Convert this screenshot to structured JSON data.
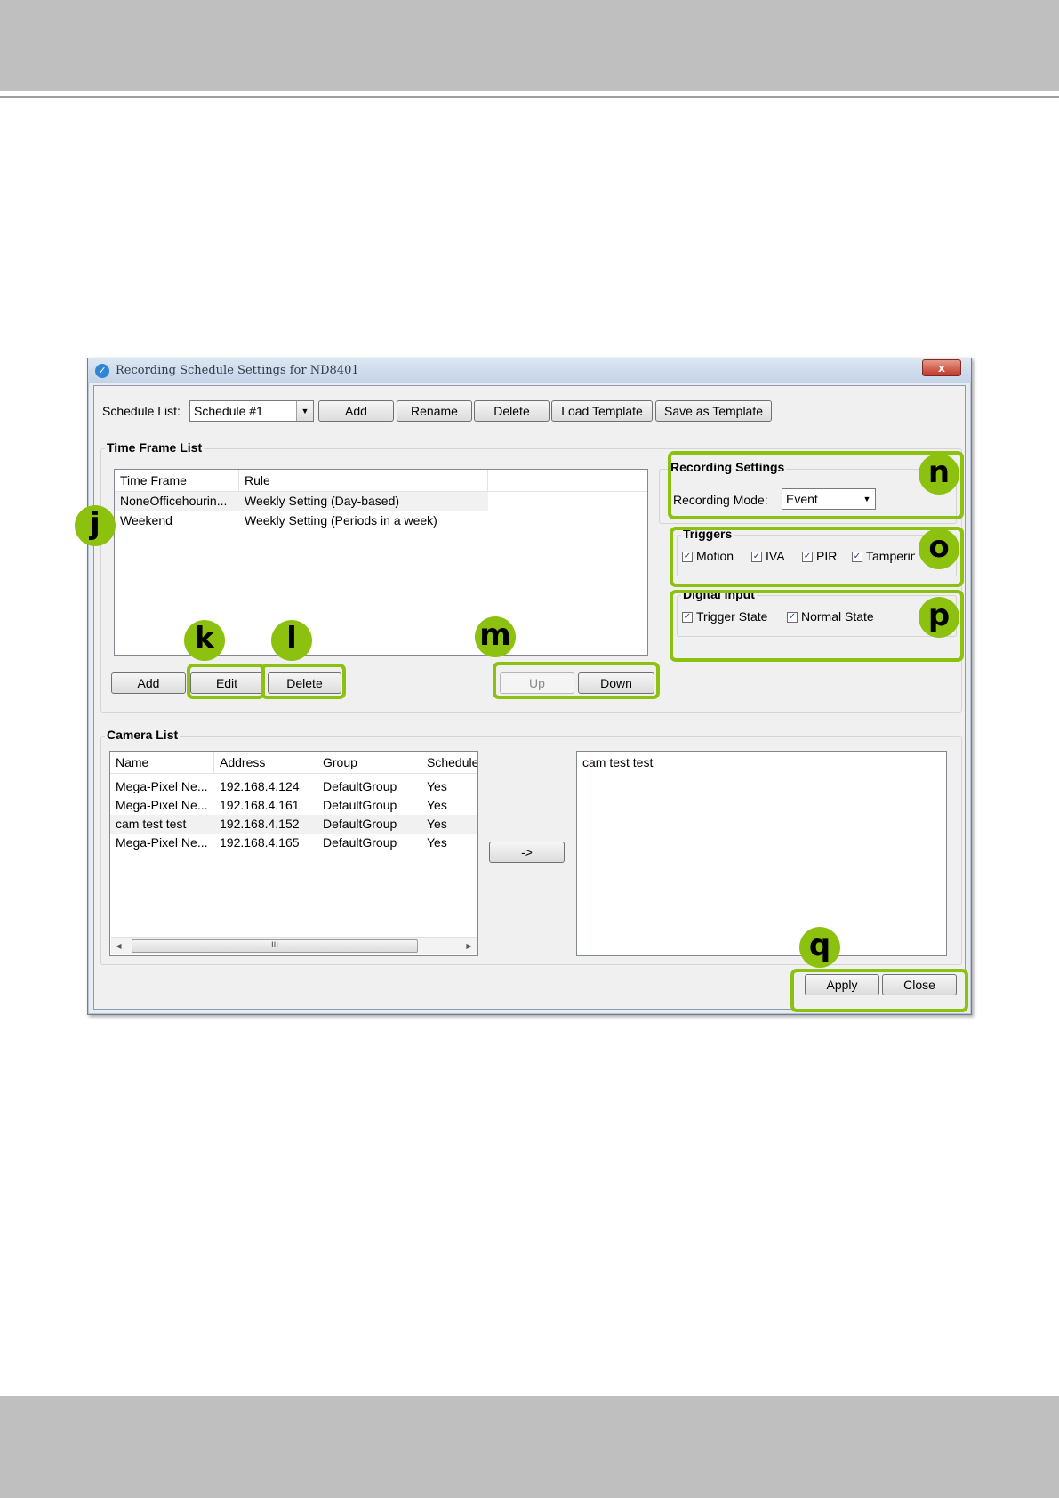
{
  "window": {
    "title": "Recording Schedule Settings for ND8401",
    "close_glyph": "x"
  },
  "schedule": {
    "label": "Schedule List:",
    "selected": "Schedule #1",
    "buttons": {
      "add": "Add",
      "rename": "Rename",
      "delete": "Delete",
      "load_template": "Load Template",
      "save_template": "Save as Template"
    }
  },
  "time_frame": {
    "title": "Time Frame List",
    "columns": [
      "Time Frame",
      "Rule"
    ],
    "rows": [
      {
        "time_frame": "NoneOfficehourin...",
        "rule": "Weekly Setting (Day-based)"
      },
      {
        "time_frame": "Weekend",
        "rule": "Weekly Setting (Periods in a week)"
      }
    ],
    "buttons": {
      "add": "Add",
      "edit": "Edit",
      "delete": "Delete",
      "up": "Up",
      "down": "Down"
    }
  },
  "recording_settings": {
    "title": "Recording Settings",
    "mode_label": "Recording Mode:",
    "mode_value": "Event"
  },
  "triggers": {
    "title": "Triggers",
    "items": [
      {
        "label": "Motion",
        "checked": true
      },
      {
        "label": "IVA",
        "checked": true
      },
      {
        "label": "PIR",
        "checked": true
      },
      {
        "label": "Tamperin",
        "checked": true
      }
    ]
  },
  "digital_input": {
    "title": "Digital Input",
    "items": [
      {
        "label": "Trigger State",
        "checked": true
      },
      {
        "label": "Normal State",
        "checked": true
      }
    ]
  },
  "camera_list": {
    "title": "Camera List",
    "columns": [
      "Name",
      "Address",
      "Group",
      "Schedule"
    ],
    "rows": [
      {
        "name": "Mega-Pixel Ne...",
        "address": "192.168.4.124",
        "group": "DefaultGroup",
        "schedule": "Yes"
      },
      {
        "name": "Mega-Pixel Ne...",
        "address": "192.168.4.161",
        "group": "DefaultGroup",
        "schedule": "Yes"
      },
      {
        "name": "cam test test",
        "address": "192.168.4.152",
        "group": "DefaultGroup",
        "schedule": "Yes"
      },
      {
        "name": "Mega-Pixel Ne...",
        "address": "192.168.4.165",
        "group": "DefaultGroup",
        "schedule": "Yes"
      }
    ],
    "scroll_thumb": "III",
    "transfer_button": "->",
    "selected_items": [
      "cam test test"
    ]
  },
  "footer": {
    "apply": "Apply",
    "close": "Close"
  },
  "callouts": {
    "j": "j",
    "k": "k",
    "l": "l",
    "m": "m",
    "n": "n",
    "o": "o",
    "p": "p",
    "q": "q"
  },
  "colors": {
    "callout_green": "#8cc20f",
    "band_gray": "#bfbfbf"
  }
}
